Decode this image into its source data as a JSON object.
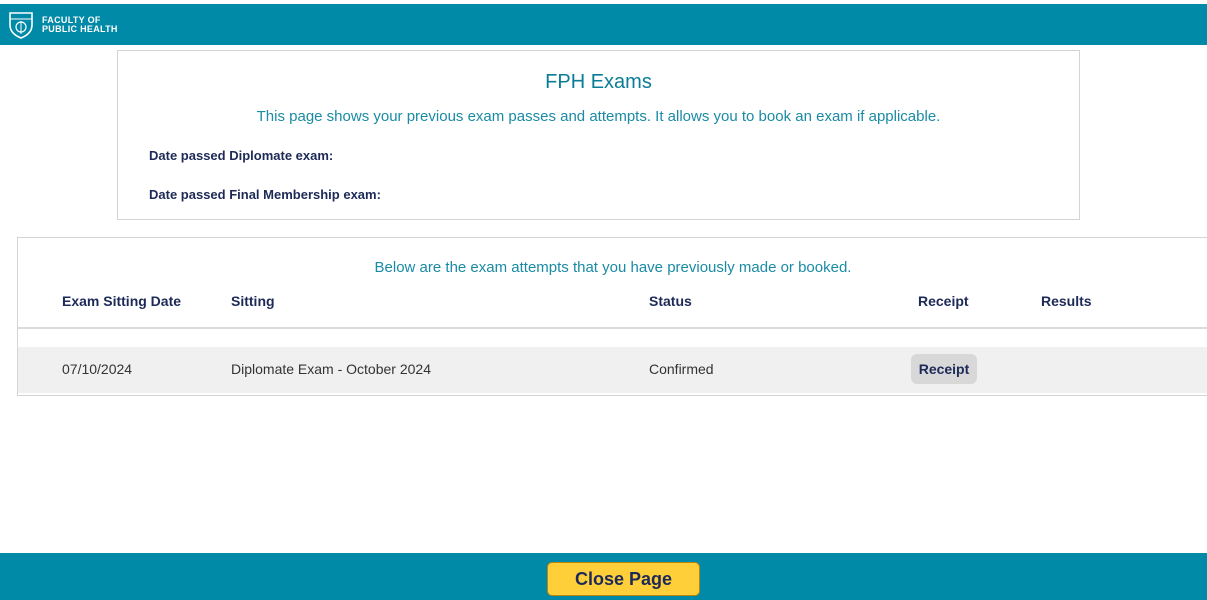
{
  "brand": {
    "line1": "FACULTY OF",
    "line2": "PUBLIC HEALTH",
    "logo_icon": "shield-crest-icon"
  },
  "summary": {
    "title": "FPH Exams",
    "description": "This page shows your previous exam passes and attempts. It allows you to book an exam if applicable.",
    "diplomate_label": "Date passed Diplomate exam:",
    "final_label": "Date passed Final Membership exam:"
  },
  "attempts": {
    "intro": "Below are the exam attempts that you have previously made or booked.",
    "columns": [
      "Exam Sitting Date",
      "Sitting",
      "Status",
      "Receipt",
      "Results"
    ],
    "rows": [
      {
        "date": "07/10/2024",
        "sitting": "Diplomate Exam - October 2024",
        "status": "Confirmed",
        "receipt_label": "Receipt",
        "results": ""
      }
    ]
  },
  "footer": {
    "close_label": "Close Page"
  },
  "colors": {
    "brand_teal": "#0189a8",
    "close_button": "#ffcf3a",
    "heading_navy": "#1d2a57"
  }
}
